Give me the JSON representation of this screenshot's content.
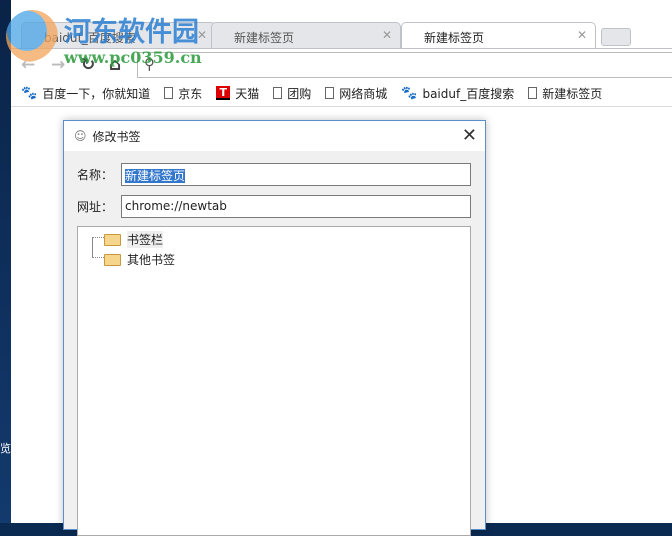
{
  "desktop": {
    "partial_text": "览器"
  },
  "watermark": {
    "title": "河东软件园",
    "url": "www.pc0359.cn"
  },
  "tabs": [
    {
      "label": "baiduf_百度搜索"
    },
    {
      "label": "新建标签页"
    },
    {
      "label": "新建标签页",
      "active": true
    }
  ],
  "bookmarks": [
    {
      "label": "百度一下，你就知道",
      "icon": "paw-icon"
    },
    {
      "label": "京东",
      "icon": "page-icon"
    },
    {
      "label": "天猫",
      "icon": "tmall-icon"
    },
    {
      "label": "团购",
      "icon": "page-icon"
    },
    {
      "label": "网络商城",
      "icon": "page-icon"
    },
    {
      "label": "baiduf_百度搜索",
      "icon": "paw-icon"
    },
    {
      "label": "新建标签页",
      "icon": "page-icon"
    }
  ],
  "dialog": {
    "title": "修改书签",
    "name_label": "名称：",
    "name_value": "新建标签页",
    "url_label": "网址：",
    "url_value": "chrome://newtab",
    "folders": [
      "书签栏",
      "其他书签"
    ]
  }
}
